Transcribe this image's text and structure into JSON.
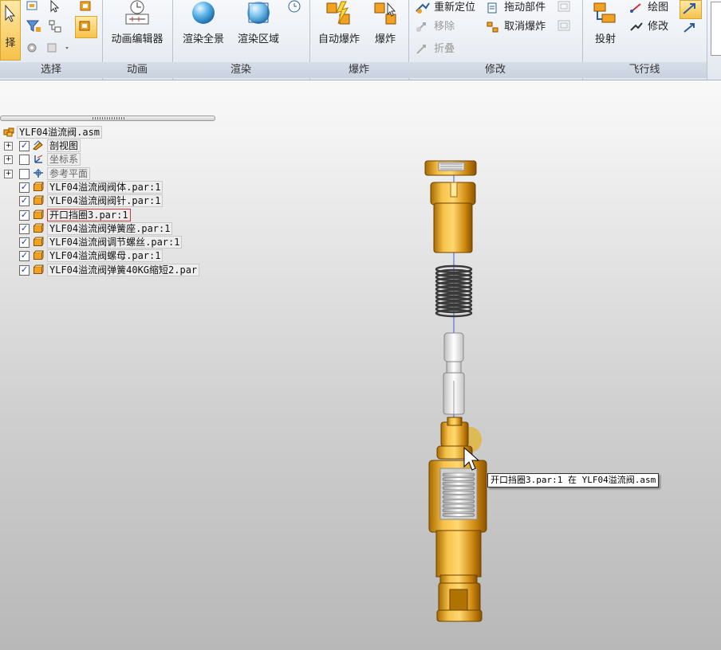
{
  "ribbon": {
    "select_group": {
      "label": "选择",
      "select_button": "择"
    },
    "animation_group": {
      "label": "动画",
      "animation_editor": "动画编辑器"
    },
    "render_group": {
      "label": "渲染",
      "render_all": "渲染全景",
      "render_region": "渲染区域"
    },
    "explode_group": {
      "label": "爆炸",
      "auto_explode": "自动爆炸",
      "explode": "爆炸"
    },
    "modify_group": {
      "label": "修改",
      "reposition": "重新定位",
      "drag_part": "拖动部件",
      "move": "移除",
      "unexplode": "取消爆炸",
      "collapse": "折叠"
    },
    "flightline_group": {
      "label": "飞行线",
      "project": "投射",
      "draw": "绘图",
      "modify": "修改"
    }
  },
  "tree": {
    "root": "YLF04溢流阀.asm",
    "items": [
      {
        "label": "剖视图",
        "checked": true,
        "expandable": true,
        "icon": "section-view-icon",
        "dim": false
      },
      {
        "label": "坐标系",
        "checked": false,
        "expandable": true,
        "icon": "coordinate-system-icon",
        "dim": true
      },
      {
        "label": "参考平面",
        "checked": false,
        "expandable": true,
        "icon": "reference-plane-icon",
        "dim": true
      },
      {
        "label": "YLF04溢流阀阀体.par:1",
        "checked": true,
        "expandable": false,
        "icon": "part-icon",
        "dim": false
      },
      {
        "label": "YLF04溢流阀阀针.par:1",
        "checked": true,
        "expandable": false,
        "icon": "part-icon",
        "dim": false
      },
      {
        "label": "开口挡圈3.par:1",
        "checked": true,
        "expandable": false,
        "icon": "part-icon",
        "dim": false,
        "selected": true
      },
      {
        "label": "YLF04溢流阀弹簧座.par:1",
        "checked": true,
        "expandable": false,
        "icon": "part-icon",
        "dim": false
      },
      {
        "label": "YLF04溢流阀调节螺丝.par:1",
        "checked": true,
        "expandable": false,
        "icon": "part-icon",
        "dim": false
      },
      {
        "label": "YLF04溢流阀螺母.par:1",
        "checked": true,
        "expandable": false,
        "icon": "part-icon",
        "dim": false
      },
      {
        "label": "YLF04溢流阀弹簧40KG缩短2.par",
        "checked": true,
        "expandable": false,
        "icon": "part-icon",
        "dim": false
      }
    ]
  },
  "tooltip": "开口挡圈3.par:1 在 YLF04溢流阀.asm",
  "colors": {
    "part_orange": "#e8a521",
    "part_dark": "#c27a00",
    "spring_dark": "#3a3a3a",
    "ribbon_accent": "#f3c21a"
  }
}
